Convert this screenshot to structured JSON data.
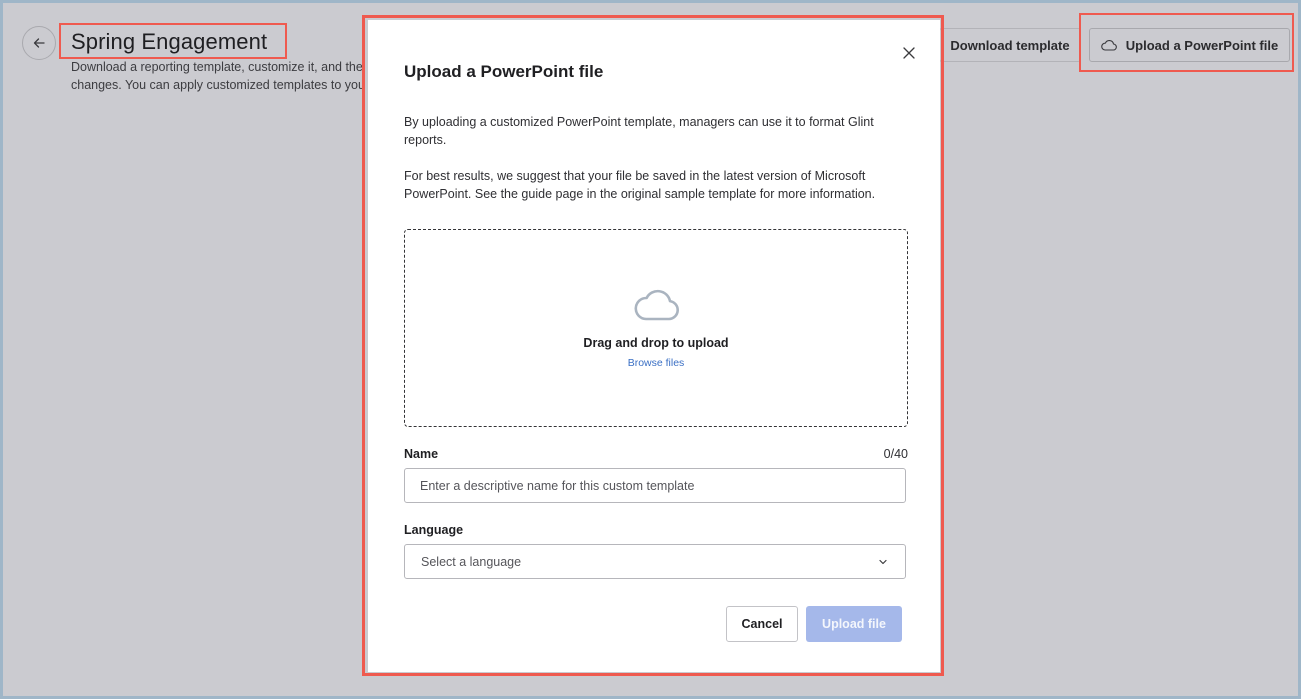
{
  "page": {
    "title": "Spring Engagement",
    "description_line1": "Download a reporting template, customize it, and the",
    "description_line2": "changes. You can apply customized templates to you",
    "back_icon": "arrow-left-icon"
  },
  "toolbar": {
    "download_label": "Download template",
    "upload_label": "Upload a PowerPoint file",
    "upload_icon": "cloud-icon"
  },
  "modal": {
    "title": "Upload a PowerPoint file",
    "close_icon": "close-icon",
    "paragraph1": "By uploading a customized PowerPoint template, managers can use it to format Glint reports.",
    "paragraph2": "For best results, we suggest that your file be saved in the latest version of Microsoft PowerPoint. See the guide page in the original sample template for more information.",
    "dropzone": {
      "icon": "cloud-icon",
      "text": "Drag and drop to upload",
      "browse_label": "Browse files"
    },
    "name_field": {
      "label": "Name",
      "count": "0/40",
      "value": "",
      "placeholder": "Enter a descriptive name for this custom template"
    },
    "language_field": {
      "label": "Language",
      "placeholder": "Select a language",
      "icon": "chevron-down-icon"
    },
    "cancel_label": "Cancel",
    "upload_label": "Upload file"
  },
  "colors": {
    "overlay": "#cbcbd0",
    "highlight": "#ef5a4f",
    "primary_disabled": "#a5b8ea",
    "link": "#3a6fc4"
  }
}
